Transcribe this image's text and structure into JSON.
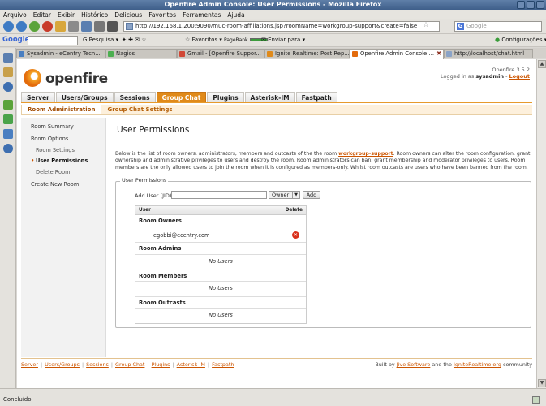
{
  "window": {
    "title": "Openfire Admin Console: User Permissions - Mozilla Firefox"
  },
  "menu": [
    "Arquivo",
    "Editar",
    "Exibir",
    "Histórico",
    "Delicious",
    "Favoritos",
    "Ferramentas",
    "Ajuda"
  ],
  "nav": {
    "url": "http://192.168.1.200:9090/muc-room-affiliations.jsp?roomName=workgroup-support&create=false",
    "search_placeholder": "Google"
  },
  "google_toolbar": {
    "logo": "Google",
    "pesquisa": "Pesquisa",
    "favoritos": "Favoritos",
    "pagerank": "PageRank",
    "enviar": "Enviar para",
    "config": "Configurações"
  },
  "tabs": [
    {
      "label": "Sysadmin - eCentry Tecn...",
      "color": "#4a7fc1"
    },
    {
      "label": "Nagios",
      "color": "#4caf50"
    },
    {
      "label": "Gmail - [Openfire Suppor...",
      "color": "#d14836"
    },
    {
      "label": "Ignite Realtime: Post Rep...",
      "color": "#e08a1a"
    },
    {
      "label": "Openfire Admin Console:...",
      "color": "#e36b0c",
      "active": true
    },
    {
      "label": "http://localhost/chat.html",
      "color": "#8aa3c7"
    }
  ],
  "header": {
    "logo_text": "openfire",
    "version": "Openfire 3.5.2",
    "logged_in_prefix": "Logged in as",
    "user": "sysadmin",
    "logout": "Logout"
  },
  "main_nav": [
    "Server",
    "Users/Groups",
    "Sessions",
    "Group Chat",
    "Plugins",
    "Asterisk-IM",
    "Fastpath"
  ],
  "main_nav_active": "Group Chat",
  "sub_nav": [
    "Room Administration",
    "Group Chat Settings"
  ],
  "left_menu": {
    "room_summary": "Room Summary",
    "room_options": "Room Options",
    "room_settings": "Room Settings",
    "user_permissions": "User Permissions",
    "delete_room": "Delete Room",
    "create_new_room": "Create New Room"
  },
  "content": {
    "title": "User Permissions",
    "desc_before": "Below is the list of room owners, administrators, members and outcasts of the the room ",
    "room_link": "workgroup-support",
    "desc_after": ". Room owners can alter the room configuration, grant ownership and administrative privileges to users and destroy the room. Room administrators can ban, grant membership and moderator privileges to users. Room members are the only allowed users to join the room when it is configured as members-only. Whilst room outcasts are users who have been banned from the room.",
    "fieldset_legend": "User Permissions",
    "add_user_label": "Add User (JID):",
    "add_user_value": "",
    "role_selected": "Owner",
    "add_button": "Add",
    "table": {
      "col_user": "User",
      "col_delete": "Delete",
      "owners_title": "Room Owners",
      "owner_entry": "egobbi@ecentry.com",
      "admins_title": "Room Admins",
      "members_title": "Room Members",
      "outcasts_title": "Room Outcasts",
      "no_users": "No Users"
    }
  },
  "footer": {
    "links": [
      "Server",
      "Users/Groups",
      "Sessions",
      "Group Chat",
      "Plugins",
      "Asterisk-IM",
      "Fastpath"
    ],
    "built_by": "Built by",
    "jive": "Jive Software",
    "and_the": "and the",
    "ignite": "IgniteRealtime.org",
    "community": "community"
  },
  "status": {
    "text": "Concluído"
  },
  "colors": {
    "accent": "#e08a1a",
    "link": "#cc5500",
    "delete": "#d9301a"
  }
}
